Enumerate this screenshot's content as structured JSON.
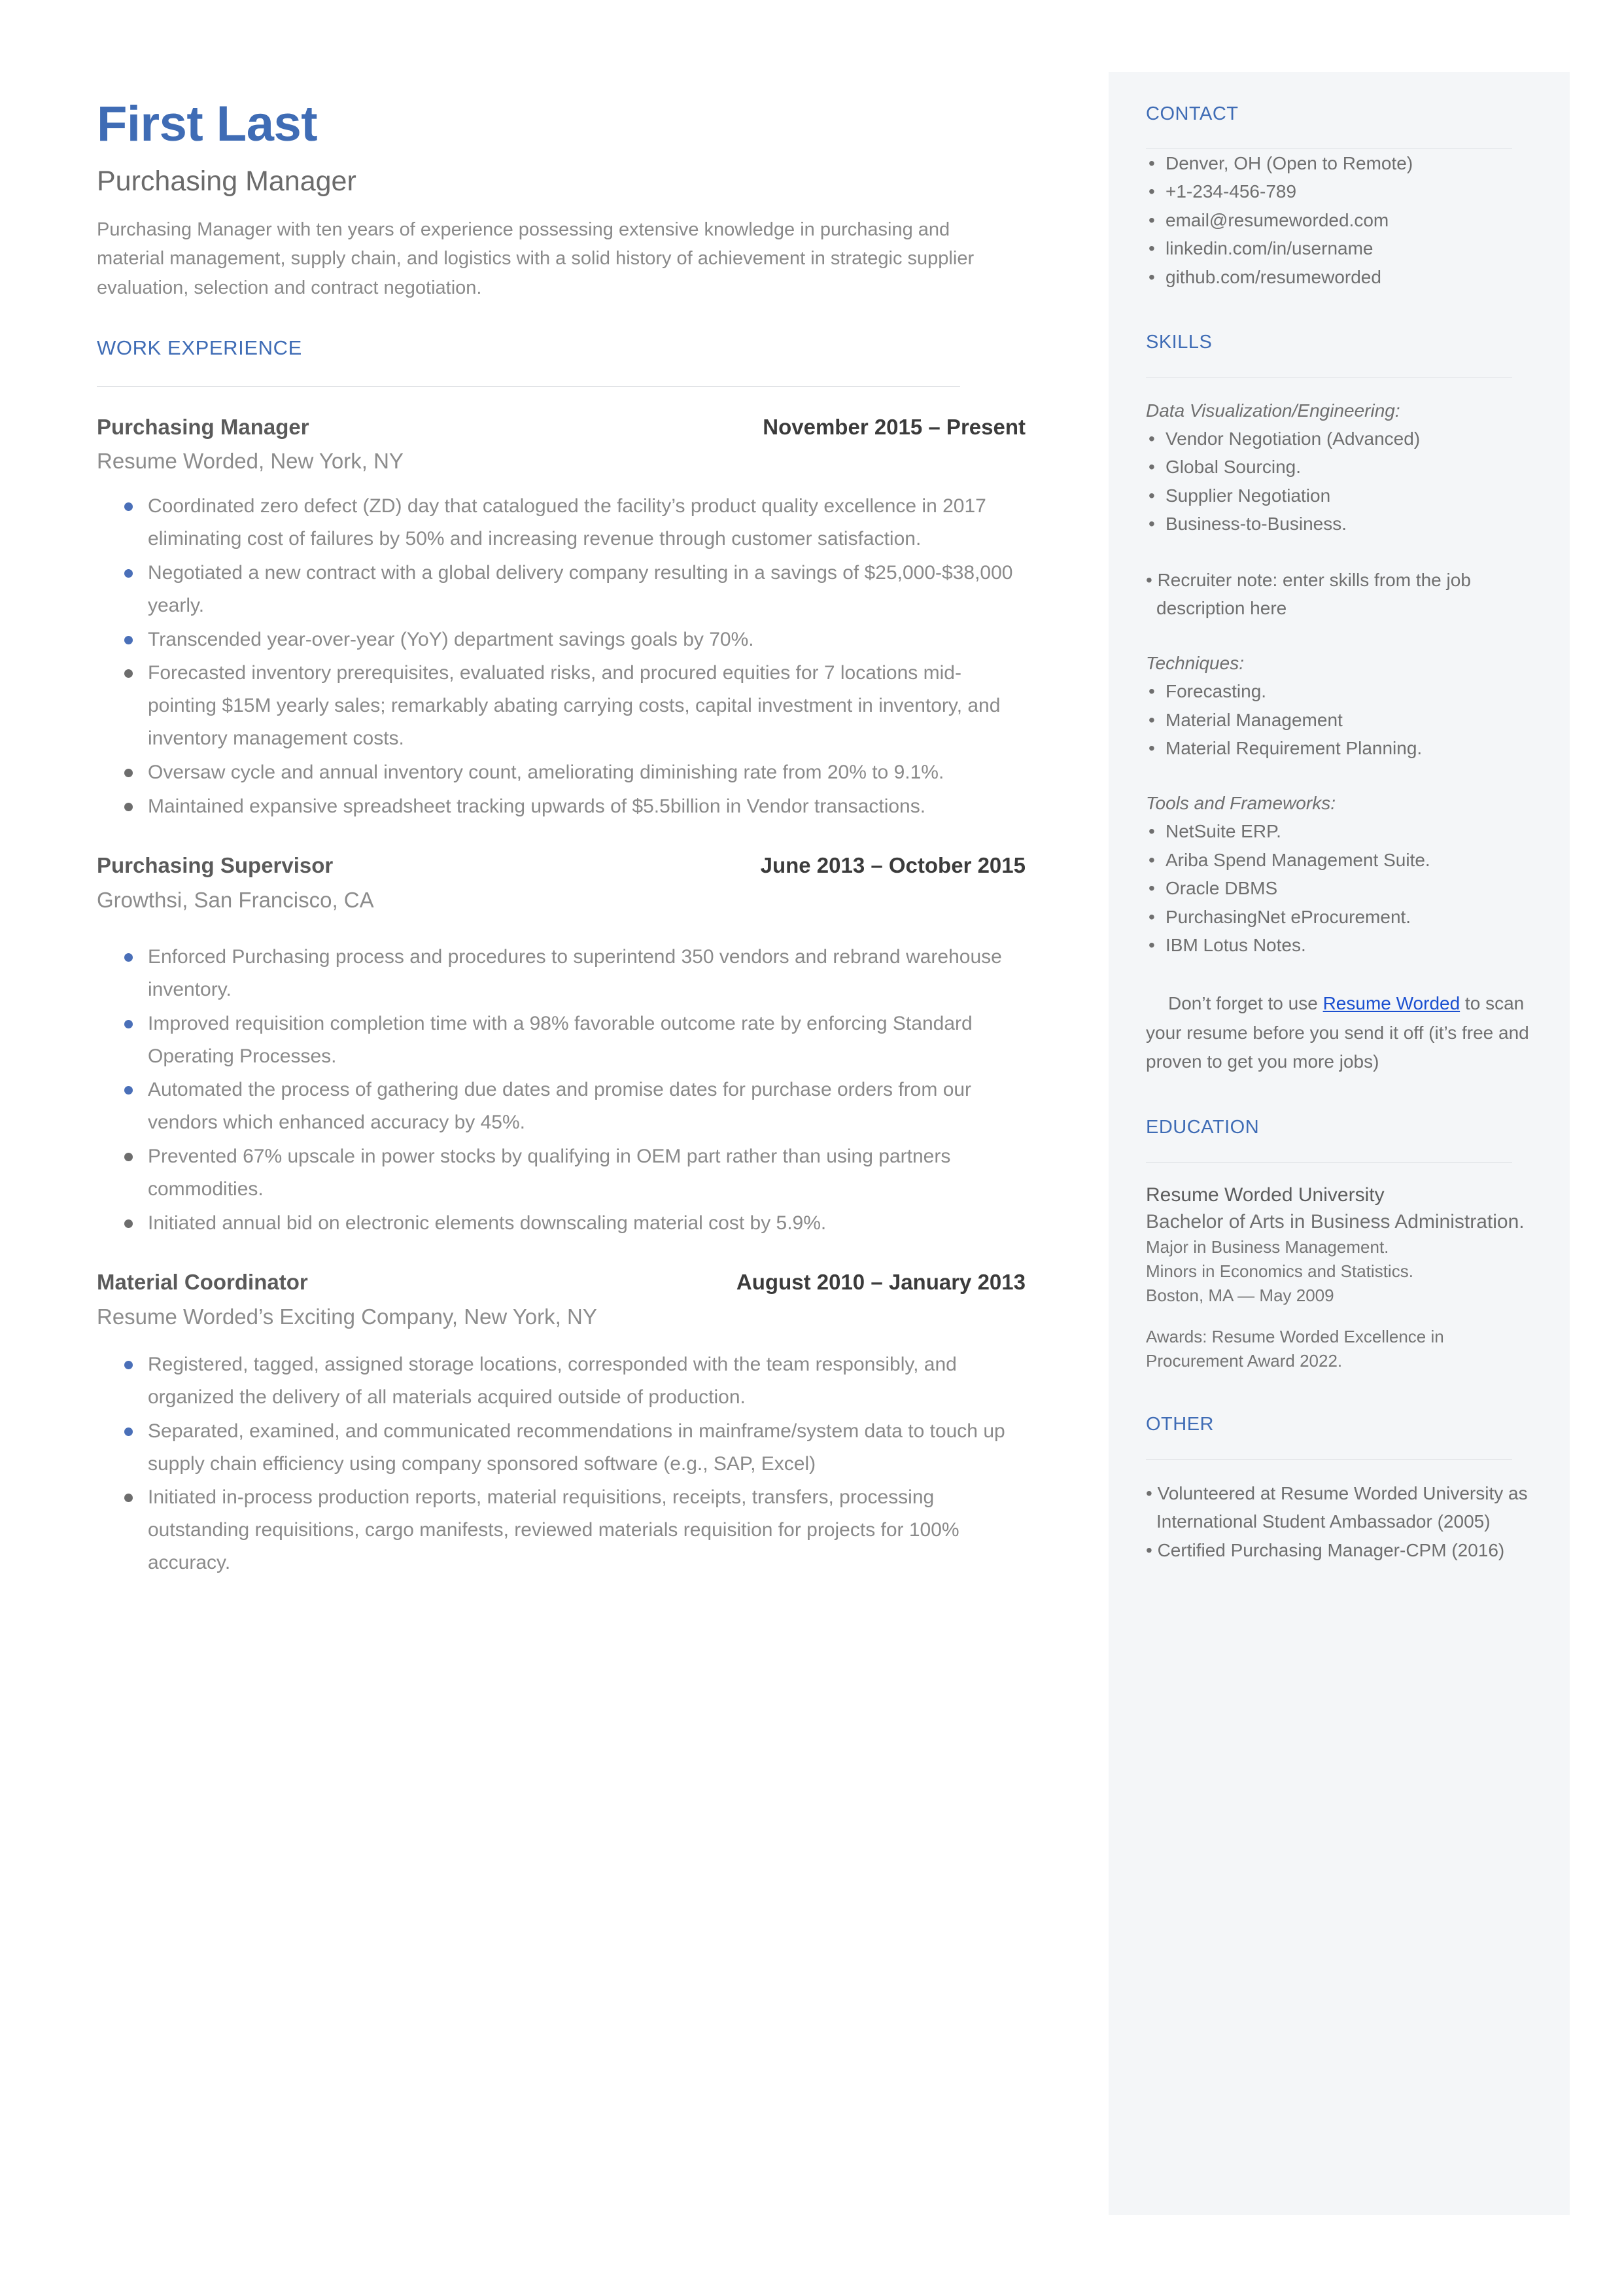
{
  "colors": {
    "accent_blue": "#3f6cb5",
    "bullet_blue": "#4a6fb8",
    "bullet_gray": "#6d6d6d",
    "link_blue": "#1a4fd0",
    "sidebar_bg": "#f4f6f8",
    "body_text": "#8a8a8a"
  },
  "header": {
    "name": "First Last",
    "headline": "Purchasing Manager",
    "summary": "Purchasing Manager with ten years of experience possessing extensive knowledge in purchasing and material management, supply chain, and logistics with a solid history of achievement in strategic supplier evaluation, selection and contract negotiation."
  },
  "work": {
    "section_title": "WORK EXPERIENCE",
    "jobs": [
      {
        "title": "Purchasing Manager",
        "dates": "November 2015 – Present",
        "company": "Resume Worded, New York, NY",
        "bullets": [
          "Coordinated zero defect (ZD) day that catalogued the facility’s product quality excellence in 2017 eliminating cost of failures by 50% and increasing revenue through customer satisfaction.",
          "Negotiated a new contract with a global delivery company resulting in a savings of $25,000-$38,000 yearly.",
          "Transcended year-over-year (YoY) department savings goals by 70%.",
          "Forecasted inventory prerequisites, evaluated risks, and procured equities for 7 locations mid-pointing $15M yearly sales; remarkably abating carrying costs, capital investment in inventory, and inventory management costs.",
          "Oversaw cycle and annual inventory count, ameliorating diminishing rate from 20% to 9.1%.",
          "Maintained expansive spreadsheet tracking upwards of $5.5billion in Vendor transactions."
        ]
      },
      {
        "title": "Purchasing Supervisor",
        "dates": "June 2013 – October 2015",
        "company": "Growthsi, San Francisco, CA",
        "bullets": [
          "Enforced Purchasing process and procedures to superintend 350 vendors and rebrand warehouse inventory.",
          "Improved requisition completion time with a 98% favorable outcome rate by enforcing Standard Operating Processes.",
          "Automated the process of gathering due dates and promise dates for purchase orders from our vendors which enhanced accuracy by 45%.",
          "Prevented 67% upscale in power stocks by qualifying in OEM part rather than using partners commodities.",
          "Initiated annual bid on electronic elements downscaling material cost by 5.9%."
        ]
      },
      {
        "title": "Material Coordinator",
        "dates": "August 2010 – January 2013",
        "company": "Resume Worded’s Exciting Company, New York, NY",
        "bullets": [
          "Registered, tagged, assigned storage locations, corresponded with the team responsibly, and organized the delivery of all materials acquired outside of production.",
          "Separated, examined, and communicated recommendations in mainframe/system data to touch up supply chain efficiency using company sponsored software (e.g., SAP, Excel)",
          "Initiated in-process production reports, material requisitions, receipts, transfers, processing outstanding requisitions, cargo manifests, reviewed materials requisition for projects for 100% accuracy."
        ]
      }
    ]
  },
  "contact": {
    "section_title": "CONTACT",
    "items": [
      "Denver, OH (Open to Remote)",
      "+1-234-456-789",
      "email@resumeworded.com",
      "linkedin.com/in/username",
      "github.com/resumeworded"
    ]
  },
  "skills": {
    "section_title": "SKILLS",
    "groups": [
      {
        "label": "Data Visualization/Engineering:",
        "items": [
          "Vendor Negotiation (Advanced)",
          "Global Sourcing.",
          "Supplier Negotiation",
          "Business-to-Business."
        ]
      },
      {
        "label": "Techniques:",
        "items": [
          "Forecasting.",
          "Material Management",
          "Material Requirement Planning."
        ]
      },
      {
        "label": "Tools and Frameworks:",
        "items": [
          "NetSuite ERP.",
          "Ariba Spend Management Suite.",
          "Oracle DBMS",
          "PurchasingNet eProcurement.",
          "IBM Lotus Notes."
        ]
      }
    ],
    "recruiter_note": "•  Recruiter note: enter skills from the job description here",
    "promo": {
      "before": "Don’t forget to use ",
      "link": "Resume Worded",
      "after": " to scan your resume before you send it off (it’s free and proven to get you more jobs)"
    }
  },
  "education": {
    "section_title": "EDUCATION",
    "school": "Resume Worded University",
    "degree": "Bachelor of Arts in Business Administration.",
    "details": [
      "Major in Business Management.",
      "Minors in Economics and Statistics.",
      "Boston, MA — May 2009"
    ],
    "awards": "Awards: Resume Worded Excellence in Procurement Award 2022."
  },
  "other": {
    "section_title": "OTHER",
    "items": [
      "• Volunteered at Resume Worded University  as International  Student Ambassador (2005)",
      "• Certified Purchasing Manager-CPM (2016)"
    ]
  },
  "glyphs": {
    "bullet_dot": "•"
  }
}
